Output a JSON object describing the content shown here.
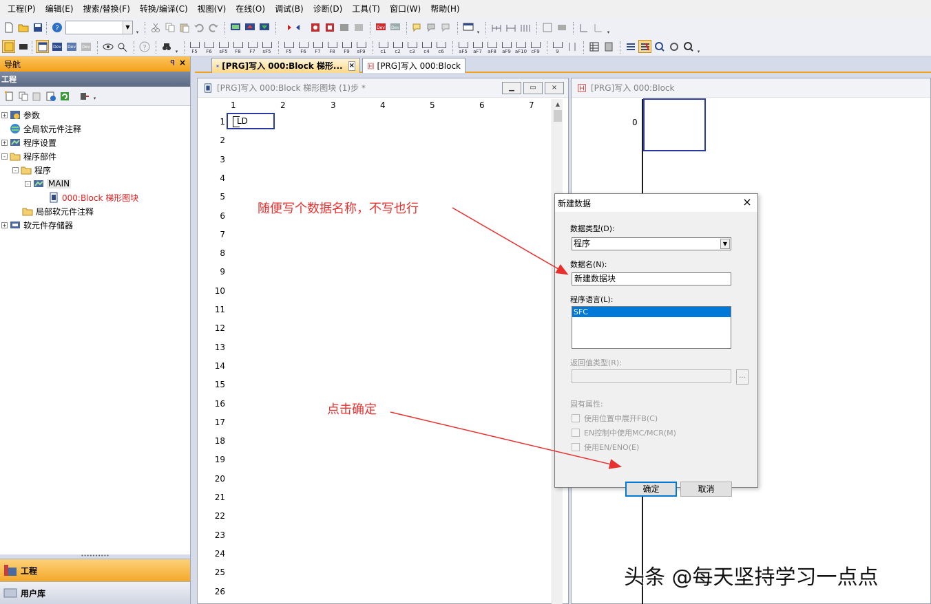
{
  "menubar": {
    "items": [
      "工程(P)",
      "编辑(E)",
      "搜索/替换(F)",
      "转换/编译(C)",
      "视图(V)",
      "在线(O)",
      "调试(B)",
      "诊断(D)",
      "工具(T)",
      "窗口(W)",
      "帮助(H)"
    ]
  },
  "toolbar": {
    "fkeys": [
      "F5",
      "F6",
      "sF5",
      "F8",
      "F7",
      "sF5",
      "F5",
      "F6",
      "F7",
      "F8",
      "F9",
      "sF9",
      "c1",
      "c2",
      "c3",
      "c4",
      "c6",
      "aF5",
      "aF7",
      "aF8",
      "aF9",
      "aF10",
      "cF9",
      "9"
    ]
  },
  "nav": {
    "title": "导航",
    "pin_glyph": "ꟼ",
    "close_glyph": "×",
    "subtitle": "工程",
    "tree": [
      {
        "label": "参数",
        "expander": "+"
      },
      {
        "label": "全局软元件注释",
        "expander": ""
      },
      {
        "label": "程序设置",
        "expander": "+"
      },
      {
        "label": "程序部件",
        "expander": "-"
      },
      {
        "label": "程序",
        "expander": "-"
      },
      {
        "label": "MAIN",
        "expander": "-"
      },
      {
        "label": "000:Block 梯形图块",
        "expander": ""
      },
      {
        "label": "局部软元件注释",
        "expander": ""
      },
      {
        "label": "软元件存储器",
        "expander": "+"
      }
    ],
    "bottom": {
      "project_label": "工程",
      "library_label": "用户库"
    }
  },
  "tabs": {
    "tab1": "[PRG]写入 000:Block 梯形...",
    "tab2": "[PRG]写入 000:Block",
    "close_glyph": "×"
  },
  "win1": {
    "title": "[PRG]写入 000:Block 梯形图块 (1)步 *",
    "min_glyph": "▭",
    "max_glyph": "▭",
    "close_glyph": "×",
    "columns": [
      "1",
      "2",
      "3",
      "4",
      "5",
      "6",
      "7"
    ],
    "rows": [
      "1",
      "2",
      "3",
      "4",
      "5",
      "6",
      "7",
      "8",
      "9",
      "10",
      "11",
      "12",
      "13",
      "14",
      "15",
      "16",
      "17",
      "18",
      "19",
      "20",
      "21",
      "22",
      "23",
      "24",
      "25",
      "26"
    ],
    "ld_text": "LD"
  },
  "win2": {
    "title": "[PRG]写入 000:Block",
    "rung_num": "0"
  },
  "dialog": {
    "title": "新建数据",
    "close_glyph": "×",
    "data_type_label": "数据类型(D):",
    "data_type_value": "程序",
    "data_name_label": "数据名(N):",
    "data_name_value": "新建数据块",
    "lang_label": "程序语言(L):",
    "lang_selected": "SFC",
    "return_type_label": "返回值类型(R):",
    "browse_glyph": "...",
    "attr_label": "固有属性:",
    "check1": "使用位置中展开FB(C)",
    "check2": "EN控制中使用MC/MCR(M)",
    "check3": "使用EN/ENO(E)",
    "ok_label": "确定",
    "cancel_label": "取消"
  },
  "annotations": {
    "note1": "随便写个数据名称，不写也行",
    "note2": "点击确定",
    "color": "#e8302f"
  },
  "watermark": "头条 @每天坚持学习一点点"
}
